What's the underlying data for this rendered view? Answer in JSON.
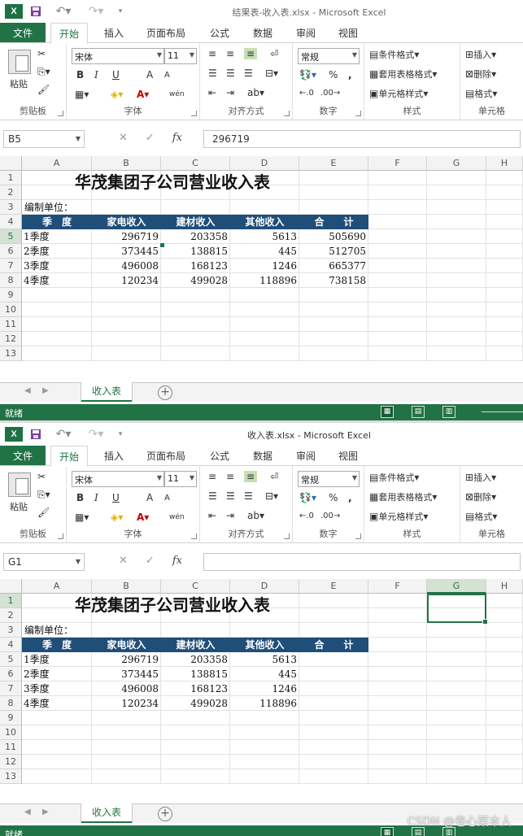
{
  "windows": [
    {
      "id": "w1",
      "title": "结果表-收入表.xlsx - Microsoft Excel",
      "name_box": "B5",
      "formula_value": "296719",
      "selected_column": "",
      "selected_row": "5",
      "columns_e_filled": true
    },
    {
      "id": "w2",
      "title": "收入表.xlsx - Microsoft Excel",
      "name_box": "G1",
      "formula_value": "",
      "selected_column": "G",
      "selected_row": "1",
      "columns_e_filled": false
    }
  ],
  "ribbon_tabs": {
    "file": "文件",
    "home": "开始",
    "insert": "插入",
    "layout": "页面布局",
    "formulas": "公式",
    "data": "数据",
    "review": "审阅",
    "view": "视图"
  },
  "ribbon": {
    "paste": "粘贴",
    "clipboard": "剪贴板",
    "font_name": "宋体",
    "font_size": "11",
    "font_group": "字体",
    "bold": "B",
    "italic": "I",
    "underline": "U",
    "grow": "A",
    "shrink": "A",
    "wen": "wén",
    "align_group": "对齐方式",
    "number_format": "常规",
    "percent": "%",
    "comma": ",",
    "number_group": "数字",
    "cond_format": "条件格式",
    "table_format": "套用表格格式",
    "cell_style": "单元格样式",
    "styles_group": "样式",
    "insert": "插入",
    "delete": "删除",
    "format": "格式",
    "cells_group": "单元格"
  },
  "formula_bar": {
    "cancel": "✕",
    "enter": "✓",
    "fx": "fx"
  },
  "columns": [
    "A",
    "B",
    "C",
    "D",
    "E",
    "F",
    "G",
    "H"
  ],
  "rows": [
    "1",
    "2",
    "3",
    "4",
    "5",
    "6",
    "7",
    "8",
    "9",
    "10",
    "11",
    "12",
    "13"
  ],
  "sheet": {
    "title": "华茂集团子公司营业收入表",
    "unit_label": "编制单位：",
    "headers": [
      "季　度",
      "家电收入",
      "建材收入",
      "其他收入",
      "合　　计"
    ],
    "data": [
      {
        "q": "1季度",
        "home": "296719",
        "build": "203358",
        "other": "5613",
        "total": "505690"
      },
      {
        "q": "2季度",
        "home": "373445",
        "build": "138815",
        "other": "445",
        "total": "512705"
      },
      {
        "q": "3季度",
        "home": "496008",
        "build": "168123",
        "other": "1246",
        "total": "665377"
      },
      {
        "q": "4季度",
        "home": "120234",
        "build": "499028",
        "other": "118896",
        "total": "738158"
      }
    ]
  },
  "sheet_tab": "收入表",
  "status": "就绪",
  "watermark": "CSDN @卷心菜本人",
  "colors": {
    "excel_green": "#217346",
    "header_band": "#1f4e79"
  }
}
